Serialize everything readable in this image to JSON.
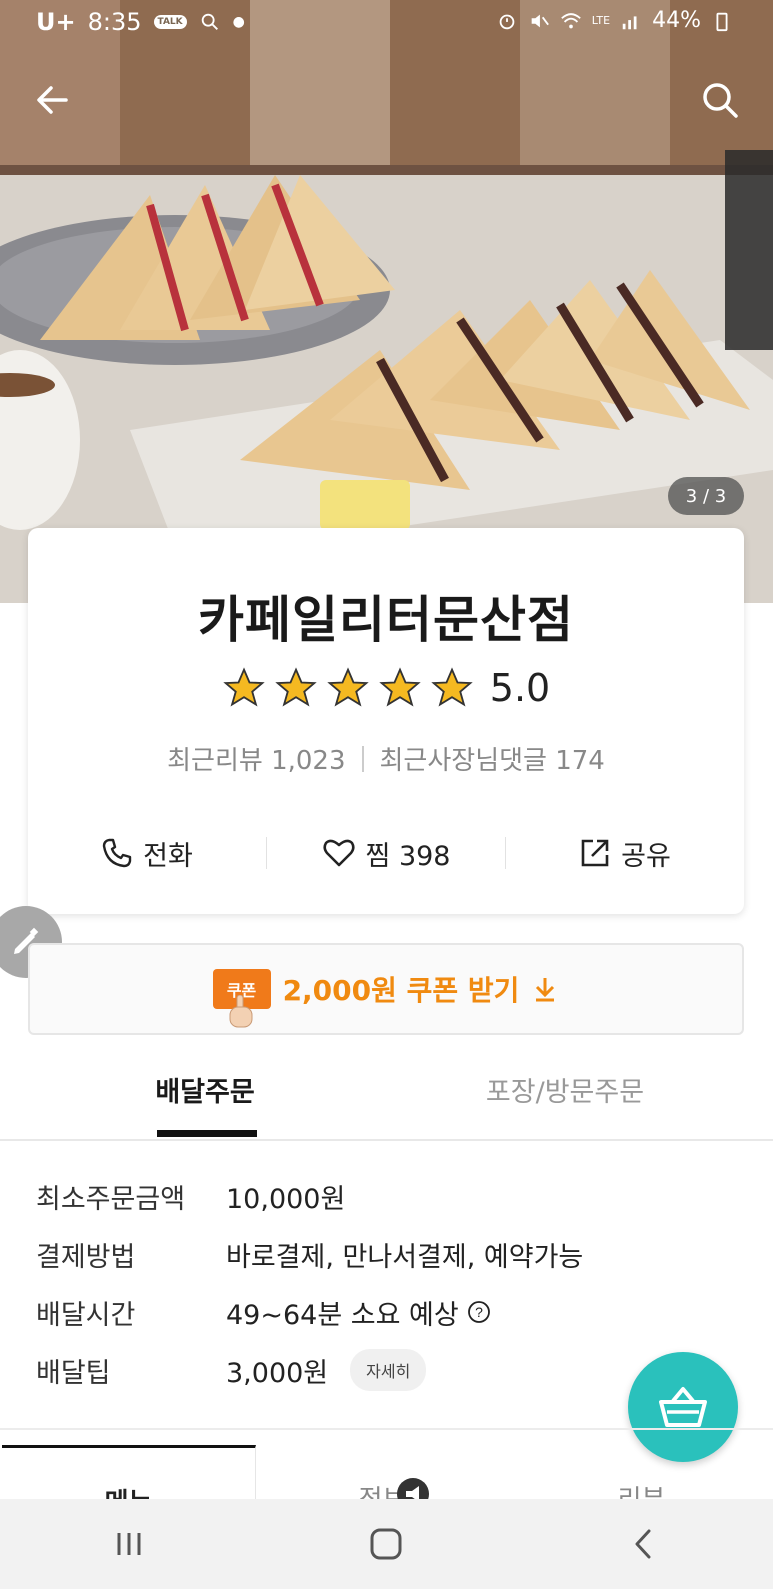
{
  "status_bar": {
    "carrier": "U+",
    "time": "8:35",
    "talk_badge": "TALK",
    "network": "LTE",
    "battery": "44%"
  },
  "hero": {
    "photo_counter": "3 / 3"
  },
  "store": {
    "name": "카페일리터문산점",
    "rating": "5.0",
    "rating_stars": 5,
    "recent_reviews": "최근리뷰 1,023",
    "owner_comments": "최근사장님댓글 174"
  },
  "actions": {
    "call": "전화",
    "favorite": "찜 398",
    "share": "공유"
  },
  "coupon": {
    "tag": "쿠폰",
    "label": "2,000원 쿠폰 받기"
  },
  "order_tabs": {
    "delivery": "배달주문",
    "pickup": "포장/방문주문"
  },
  "info": {
    "min_order": {
      "label": "최소주문금액",
      "value": "10,000원"
    },
    "payment": {
      "label": "결제방법",
      "value": "바로결제, 만나서결제, 예약가능"
    },
    "delivery_time": {
      "label": "배달시간",
      "value": "49~64분 소요 예상"
    },
    "delivery_tip": {
      "label": "배달팁",
      "value": "3,000원",
      "detail": "자세히"
    }
  },
  "content_tabs": {
    "menu": "메뉴",
    "info": "정보",
    "review": "리뷰"
  },
  "colors": {
    "accent": "#2ac1bc",
    "coupon": "#f08a10",
    "star": "#f5b921"
  }
}
